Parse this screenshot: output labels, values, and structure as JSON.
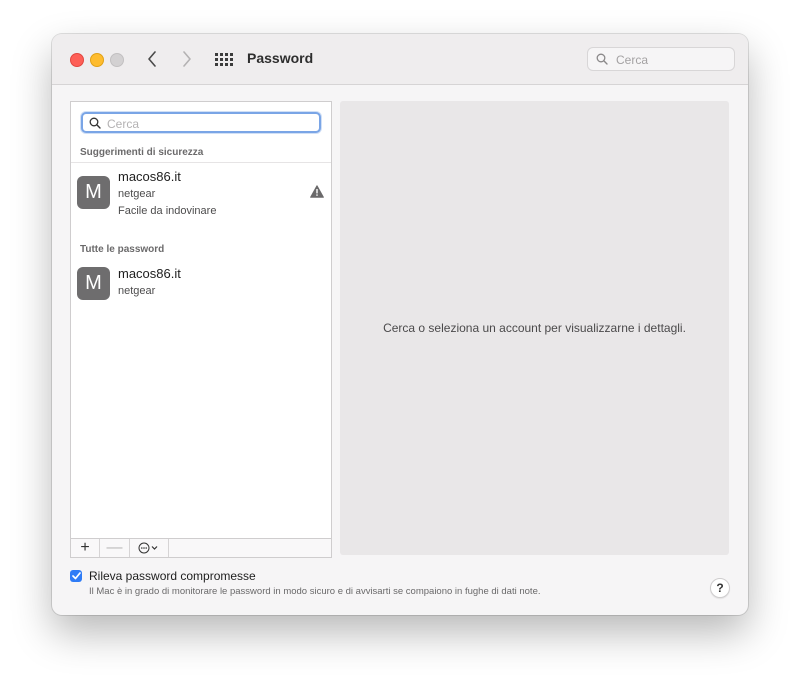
{
  "window": {
    "title": "Password",
    "search_placeholder": "Cerca"
  },
  "sidebar": {
    "search_placeholder": "Cerca",
    "section_security": "Suggerimenti di sicurezza",
    "section_all": "Tutte le password",
    "security_items": [
      {
        "avatar": "M",
        "title": "macos86.it",
        "username": "netgear",
        "warning": "Facile da indovinare",
        "icon": "warning-triangle-icon"
      }
    ],
    "all_items": [
      {
        "avatar": "M",
        "title": "macos86.it",
        "username": "netgear"
      }
    ],
    "toolbar": {
      "add": "+",
      "remove": "—"
    }
  },
  "detail": {
    "empty_message": "Cerca o seleziona un account per visualizzarne i dettagli."
  },
  "footer": {
    "checkbox_checked": true,
    "checkbox_label": "Rileva password compromesse",
    "checkbox_description": "Il Mac è in grado di monitorare le password in modo sicuro e di avvisarti se compaiono in fughe di dati note.",
    "help": "?"
  },
  "colors": {
    "close": "#fe5f57",
    "minimize": "#febc2e",
    "accent": "#2f7cf6",
    "focus_ring": "#7aa5e6"
  }
}
